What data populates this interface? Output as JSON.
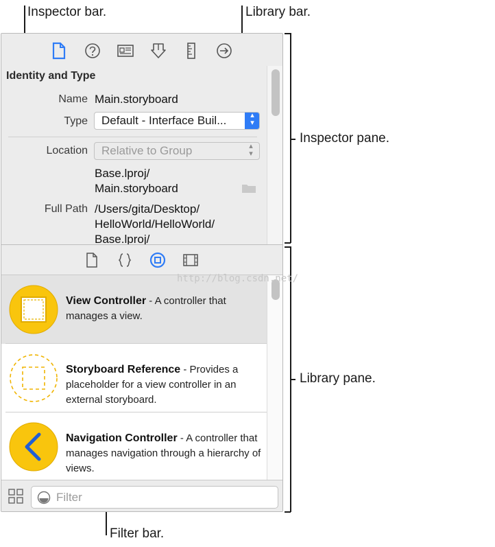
{
  "annotations": {
    "inspector_bar": "Inspector bar.",
    "library_bar": "Library bar.",
    "inspector_pane": "Inspector pane.",
    "library_pane": "Library pane.",
    "filter_bar": "Filter bar."
  },
  "inspector_bar": {
    "icons": [
      "file-inspector-icon",
      "quick-help-icon",
      "identity-inspector-icon",
      "attributes-inspector-icon",
      "size-inspector-icon",
      "connections-inspector-icon"
    ],
    "selected": "file-inspector-icon",
    "accent_color": "#2f7cf6"
  },
  "inspector_pane": {
    "section_title": "Identity and Type",
    "name_label": "Name",
    "name_value": "Main.storyboard",
    "type_label": "Type",
    "type_value": "Default - Interface Buil...",
    "location_label": "Location",
    "location_value": "Relative to Group",
    "location_path_line1": "Base.lproj/",
    "location_path_line2": "Main.storyboard",
    "full_path_label": "Full Path",
    "full_path_line1": "/Users/gita/Desktop/",
    "full_path_line2": "HelloWorld/HelloWorld/",
    "full_path_line3": "Base.lproj/"
  },
  "library_bar": {
    "icons": [
      "file-template-icon",
      "code-snippet-icon",
      "object-library-icon",
      "media-library-icon"
    ],
    "selected": "object-library-icon",
    "watermark": "http://blog.csdn.net/"
  },
  "library_pane": {
    "items": [
      {
        "title": "View Controller",
        "description": " - A controller that manages a view.",
        "icon": "view-controller-icon",
        "selected": true
      },
      {
        "title": "Storyboard Reference",
        "description": " - Provides a placeholder for a view controller in an external storyboard.",
        "icon": "storyboard-reference-icon",
        "selected": false
      },
      {
        "title": "Navigation Controller",
        "description": " - A controller that manages navigation through a hierarchy of views.",
        "icon": "navigation-controller-icon",
        "selected": false
      }
    ],
    "icon_color": "#f9c50d"
  },
  "filter_bar": {
    "placeholder": "Filter",
    "view_toggle_icon": "grid-view-icon"
  }
}
